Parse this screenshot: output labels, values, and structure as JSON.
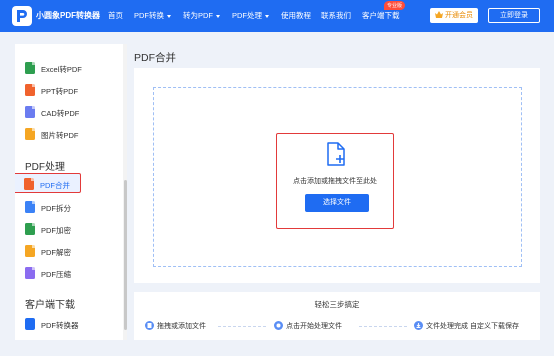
{
  "header": {
    "brand": "小圆象PDF转换器",
    "nav": [
      {
        "label": "首页",
        "dropdown": false
      },
      {
        "label": "PDF转换",
        "dropdown": true
      },
      {
        "label": "转为PDF",
        "dropdown": true
      },
      {
        "label": "PDF处理",
        "dropdown": true
      },
      {
        "label": "使用教程",
        "dropdown": false
      },
      {
        "label": "联系我们",
        "dropdown": false
      },
      {
        "label": "客户端下载",
        "dropdown": false
      }
    ],
    "badge": "专业版",
    "vip_label": "开通会员",
    "login_label": "立即登录"
  },
  "sidebar": {
    "convert_items": [
      {
        "label": "Excel转PDF",
        "icon": "excel-icon",
        "color": "#2e9e4f"
      },
      {
        "label": "PPT转PDF",
        "icon": "ppt-icon",
        "color": "#f0622d"
      },
      {
        "label": "CAD转PDF",
        "icon": "cad-icon",
        "color": "#6b7cf0"
      },
      {
        "label": "图片转PDF",
        "icon": "image-icon",
        "color": "#f5a623"
      }
    ],
    "process_heading": "PDF处理",
    "process_items": [
      {
        "label": "PDF合并",
        "icon": "merge-icon",
        "color": "#f0622d",
        "active": true
      },
      {
        "label": "PDF拆分",
        "icon": "split-icon",
        "color": "#3b82f6",
        "active": false
      },
      {
        "label": "PDF加密",
        "icon": "encrypt-icon",
        "color": "#2e9e4f",
        "active": false
      },
      {
        "label": "PDF解密",
        "icon": "decrypt-icon",
        "color": "#f5a623",
        "active": false
      },
      {
        "label": "PDF压缩",
        "icon": "compress-icon",
        "color": "#8b6cf0",
        "active": false
      }
    ],
    "client_heading": "客户端下载",
    "client_items": [
      {
        "label": "PDF转换器",
        "icon": "app-logo-icon",
        "color": "#1f6cf2"
      }
    ]
  },
  "main": {
    "title": "PDF合并",
    "drop_text": "点击添加或拖拽文件至此处",
    "select_button": "选择文件"
  },
  "steps": {
    "title": "轻松三步搞定",
    "items": [
      {
        "label": "拖拽或添加文件"
      },
      {
        "label": "点击开始处理文件"
      },
      {
        "label": "文件处理完成 自定义下载保存"
      }
    ]
  },
  "colors": {
    "primary": "#1f6cf2",
    "highlight": "#e23a3a",
    "vip": "#e88a00"
  }
}
